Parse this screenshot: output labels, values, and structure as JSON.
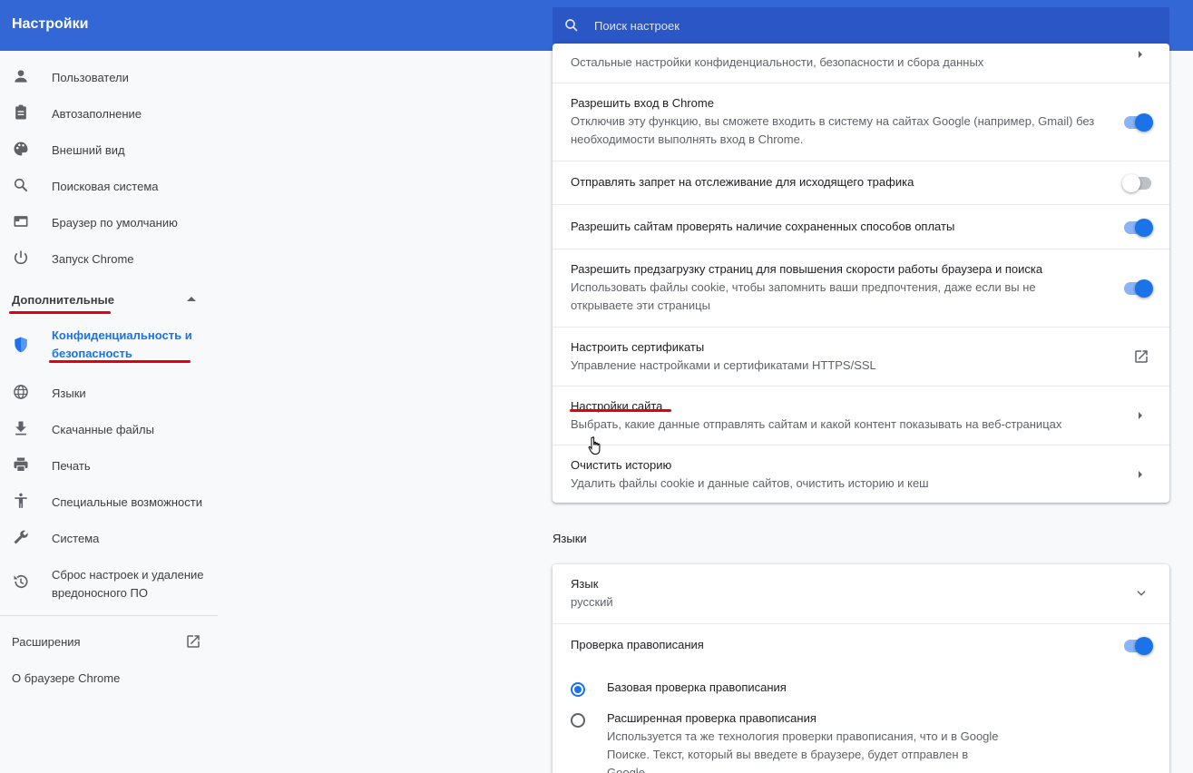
{
  "header": {
    "title": "Настройки",
    "search_placeholder": "Поиск настроек"
  },
  "sidebar": {
    "items": [
      {
        "label": "Пользователи",
        "icon": "person-icon"
      },
      {
        "label": "Автозаполнение",
        "icon": "clipboard-icon"
      },
      {
        "label": "Внешний вид",
        "icon": "palette-icon"
      },
      {
        "label": "Поисковая система",
        "icon": "search-icon"
      },
      {
        "label": "Браузер по умолчанию",
        "icon": "browser-icon"
      },
      {
        "label": "Запуск Chrome",
        "icon": "power-icon"
      }
    ],
    "advanced_label": "Дополнительные",
    "advanced_items": [
      {
        "label": "Конфиденциальность и безопасность",
        "icon": "shield-icon"
      },
      {
        "label": "Языки",
        "icon": "globe-icon"
      },
      {
        "label": "Скачанные файлы",
        "icon": "download-icon"
      },
      {
        "label": "Печать",
        "icon": "printer-icon"
      },
      {
        "label": "Специальные возможности",
        "icon": "accessibility-icon"
      },
      {
        "label": "Система",
        "icon": "wrench-icon"
      },
      {
        "label": "Сброс настроек и удаление вредоносного ПО",
        "icon": "restore-icon"
      }
    ],
    "extensions_label": "Расширения",
    "about_label": "О браузере Chrome"
  },
  "privacy": {
    "top_partial": "Остальные настройки конфиденциальности, безопасности и сбора данных",
    "rows": [
      {
        "title": "Разрешить вход в Chrome",
        "desc": "Отключив эту функцию, вы сможете входить в систему на сайтах Google (например, Gmail) без необходимости выполнять вход в Chrome.",
        "toggle": true
      },
      {
        "title": "Отправлять запрет на отслеживание для исходящего трафика",
        "desc": "",
        "toggle": false
      },
      {
        "title": "Разрешить сайтам проверять наличие сохраненных способов оплаты",
        "desc": "",
        "toggle": true
      },
      {
        "title": "Разрешить предзагрузку страниц для повышения скорости работы браузера и поиска",
        "desc": "Использовать файлы cookie, чтобы запомнить ваши предпочтения, даже если вы не открываете эти страницы",
        "toggle": true
      },
      {
        "title": "Настроить сертификаты",
        "desc": "Управление настройками и сертификатами HTTPS/SSL"
      },
      {
        "title": "Настройки сайта",
        "desc": "Выбрать, какие данные отправлять сайтам и какой контент показывать на веб-страницах"
      },
      {
        "title": "Очистить историю",
        "desc": "Удалить файлы cookie и данные сайтов, очистить историю и кеш"
      }
    ]
  },
  "languages": {
    "section_title": "Языки",
    "language_label": "Язык",
    "language_value": "русский",
    "spellcheck_label": "Проверка правописания",
    "spellcheck_on": true,
    "basic_label": "Базовая проверка правописания",
    "enhanced_label": "Расширенная проверка правописания",
    "enhanced_desc": "Используется та же технология проверки правописания, что и в Google Поиске. Текст, который вы введете в браузере, будет отправлен в Google."
  },
  "colors": {
    "header": "#3367d6",
    "accent": "#1a73e8",
    "annotation": "#e3000f"
  }
}
